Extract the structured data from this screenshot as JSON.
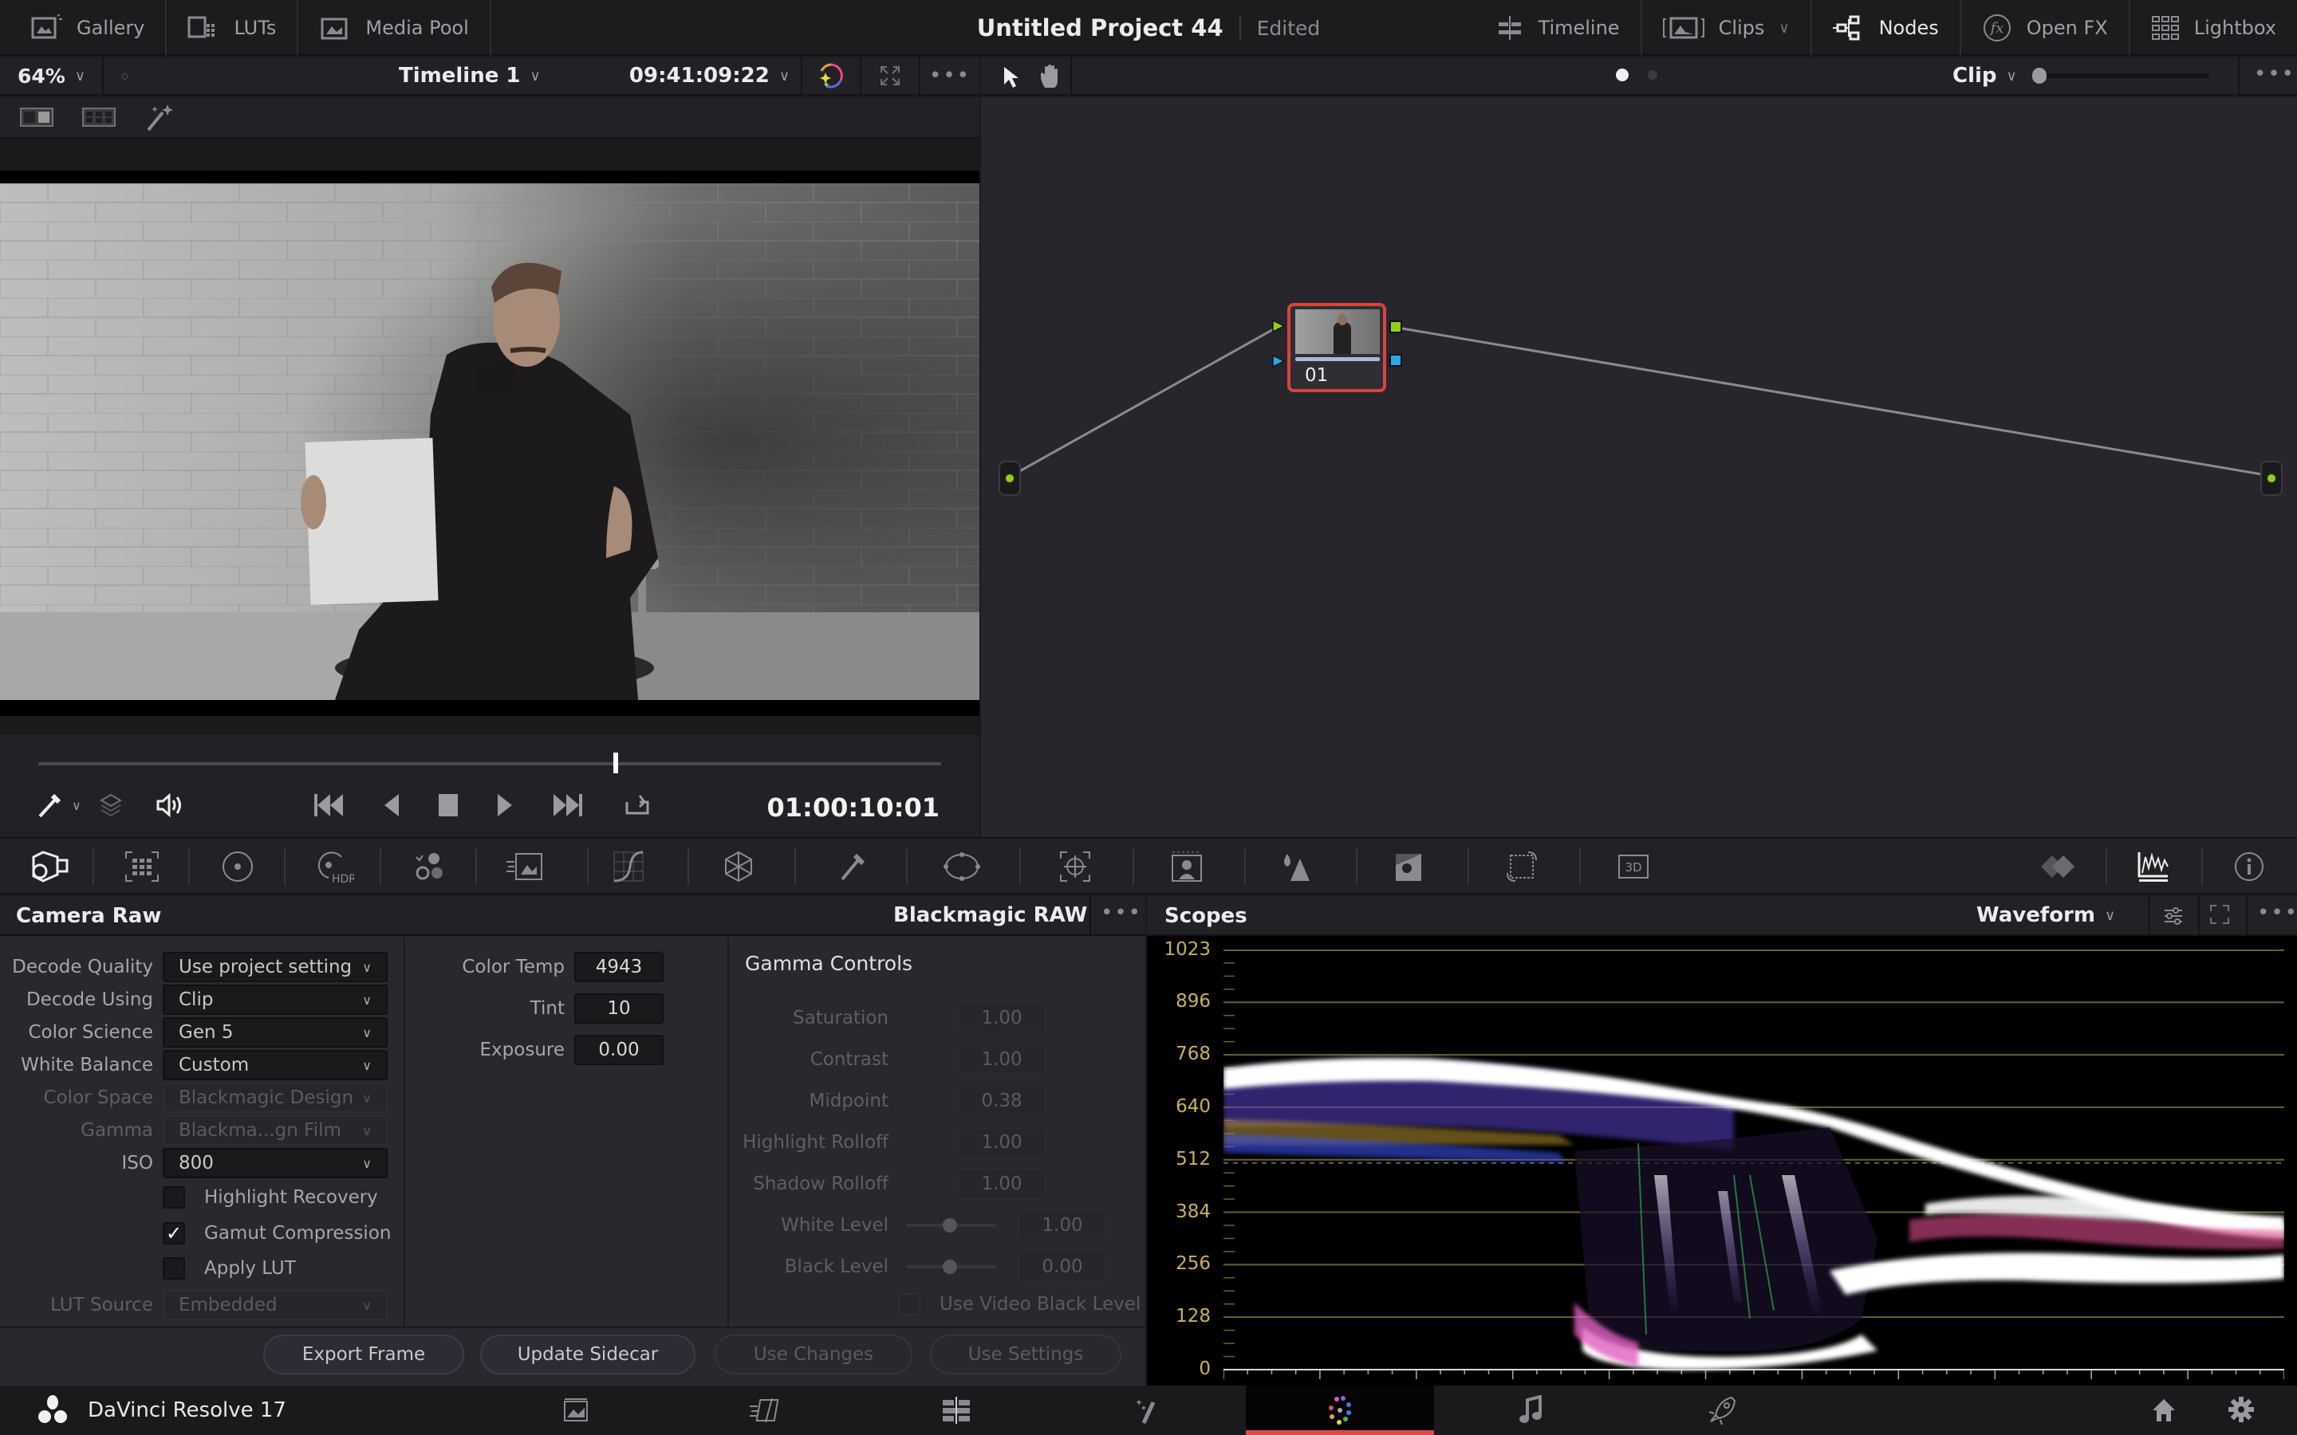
{
  "topbar": {
    "left_items": [
      {
        "label": "Gallery",
        "icon": "gallery-icon"
      },
      {
        "label": "LUTs",
        "icon": "luts-icon"
      },
      {
        "label": "Media Pool",
        "icon": "media-pool-icon"
      }
    ],
    "project_title": "Untitled Project 44",
    "project_status": "Edited",
    "right_items": [
      {
        "label": "Timeline",
        "icon": "timeline-icon"
      },
      {
        "label": "Clips",
        "icon": "clips-icon",
        "has_dropdown": true
      },
      {
        "label": "Nodes",
        "icon": "nodes-icon",
        "active": true
      },
      {
        "label": "Open FX",
        "icon": "openfx-icon"
      },
      {
        "label": "Lightbox",
        "icon": "lightbox-icon"
      }
    ]
  },
  "viewer": {
    "zoom": "64%",
    "timeline_name": "Timeline 1",
    "source_timecode": "09:41:09:22",
    "current_timecode": "01:00:10:01",
    "playhead_fraction": 0.64
  },
  "nodes": {
    "mode": "Clip",
    "node_label": "01",
    "accent_input_green": "#8fd11a",
    "accent_input_blue": "#2aa8e8",
    "node_border": "#d9443c"
  },
  "camera_raw": {
    "title": "Camera Raw",
    "codec": "Blackmagic RAW",
    "rows": [
      {
        "label": "Decode Quality",
        "value": "Use project setting",
        "disabled": false
      },
      {
        "label": "Decode Using",
        "value": "Clip",
        "disabled": false
      },
      {
        "label": "Color Science",
        "value": "Gen 5",
        "disabled": false
      },
      {
        "label": "White Balance",
        "value": "Custom",
        "disabled": false
      },
      {
        "label": "Color Space",
        "value": "Blackmagic Design",
        "disabled": true
      },
      {
        "label": "Gamma",
        "value": "Blackma...gn Film",
        "disabled": true
      },
      {
        "label": "ISO",
        "value": "800",
        "disabled": false
      }
    ],
    "checkboxes": [
      {
        "label": "Highlight Recovery",
        "checked": false
      },
      {
        "label": "Gamut Compression",
        "checked": true
      },
      {
        "label": "Apply LUT",
        "checked": false
      }
    ],
    "lut_source": {
      "label": "LUT Source",
      "value": "Embedded",
      "disabled": true
    },
    "wb_fields": [
      {
        "label": "Color Temp",
        "value": "4943"
      },
      {
        "label": "Tint",
        "value": "10"
      },
      {
        "label": "Exposure",
        "value": "0.00"
      }
    ],
    "gamma_controls": {
      "title": "Gamma Controls",
      "fields": [
        {
          "label": "Saturation",
          "value": "1.00"
        },
        {
          "label": "Contrast",
          "value": "1.00"
        },
        {
          "label": "Midpoint",
          "value": "0.38"
        },
        {
          "label": "Highlight Rolloff",
          "value": "1.00"
        },
        {
          "label": "Shadow Rolloff",
          "value": "1.00"
        }
      ],
      "sliders": [
        {
          "label": "White Level",
          "value": "1.00",
          "fraction": 0.5
        },
        {
          "label": "Black Level",
          "value": "0.00",
          "fraction": 0.5
        }
      ],
      "video_black": {
        "label": "Use Video Black Level",
        "checked": false
      }
    },
    "buttons": [
      {
        "label": "Export Frame",
        "disabled": false
      },
      {
        "label": "Update Sidecar",
        "disabled": false
      },
      {
        "label": "Use Changes",
        "disabled": true
      },
      {
        "label": "Use Settings",
        "disabled": true
      }
    ]
  },
  "scopes": {
    "title": "Scopes",
    "mode": "Waveform",
    "y_ticks": [
      "1023",
      "896",
      "768",
      "640",
      "512",
      "384",
      "256",
      "128",
      "0"
    ],
    "tick_color": "#c8b060"
  },
  "bottombar": {
    "app_name": "DaVinci Resolve 17",
    "pages": [
      "media",
      "cut",
      "edit",
      "fusion",
      "color",
      "fairlight",
      "deliver"
    ],
    "active_page": "color",
    "active_color": "#e04a4a"
  }
}
